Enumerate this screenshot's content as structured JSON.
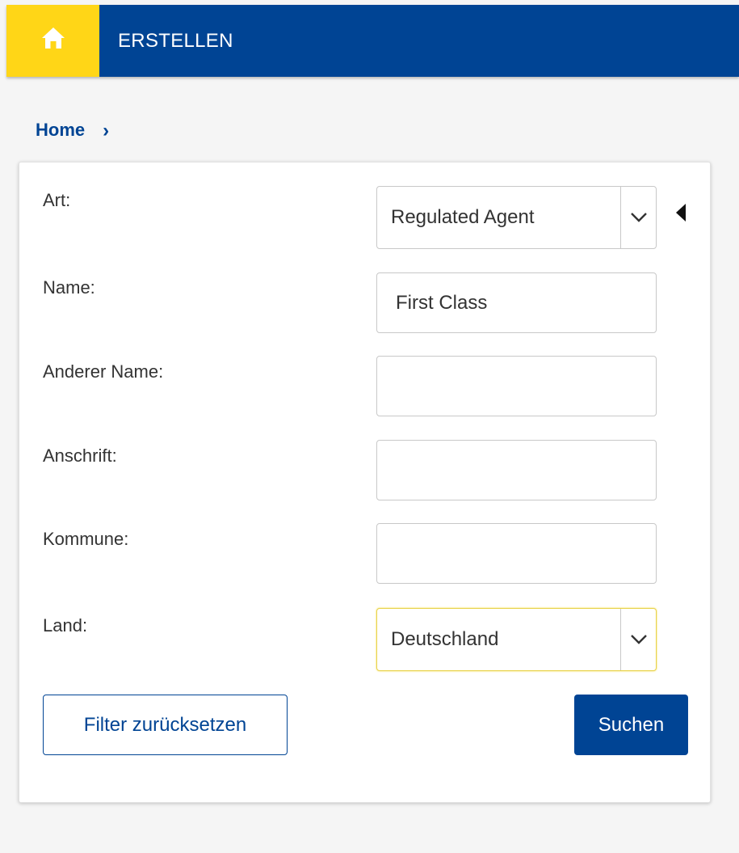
{
  "header": {
    "title": "ERSTELLEN",
    "home_icon": "home-icon",
    "colors": {
      "bar": "#004494",
      "home_tile": "#ffd617"
    }
  },
  "breadcrumb": {
    "home": "Home",
    "separator": "›"
  },
  "form": {
    "art": {
      "label": "Art:",
      "value": "Regulated Agent"
    },
    "name": {
      "label": "Name:",
      "value": "First Class"
    },
    "anderer_name": {
      "label": "Anderer Name:",
      "value": ""
    },
    "anschrift": {
      "label": "Anschrift:",
      "value": ""
    },
    "kommune": {
      "label": "Kommune:",
      "value": ""
    },
    "land": {
      "label": "Land:",
      "value": "Deutschland"
    }
  },
  "buttons": {
    "reset": "Filter zurücksetzen",
    "search": "Suchen"
  }
}
